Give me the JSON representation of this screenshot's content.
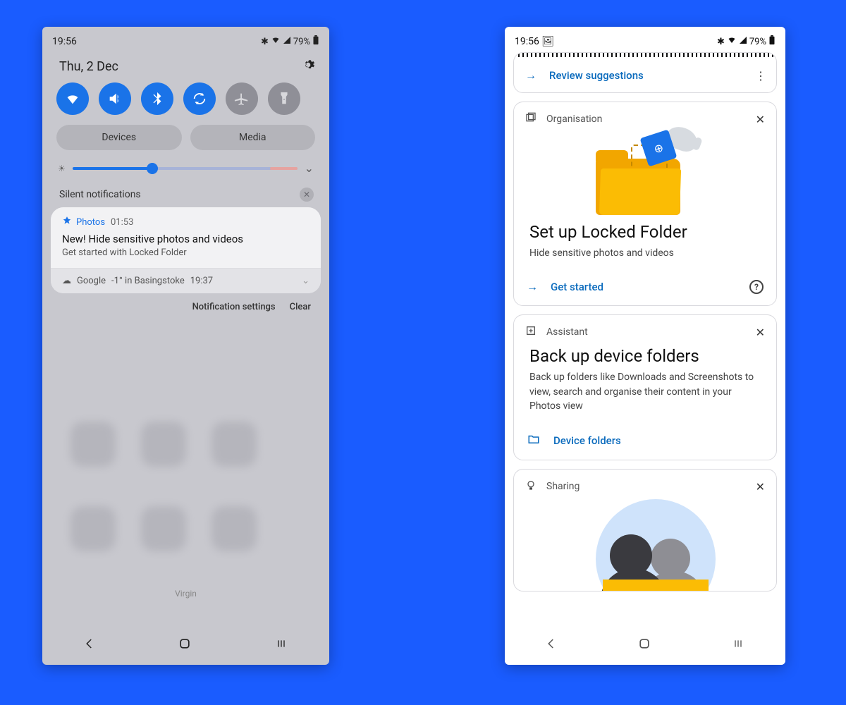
{
  "left": {
    "status": {
      "time": "19:56",
      "battery": "79%"
    },
    "date": "Thu, 2 Dec",
    "pills": {
      "devices": "Devices",
      "media": "Media"
    },
    "silent_label": "Silent notifications",
    "notification": {
      "app": "Photos",
      "time": "01:53",
      "title": "New! Hide sensitive photos and videos",
      "subtitle": "Get started with Locked Folder"
    },
    "weather": {
      "app": "Google",
      "text": "-1° in Basingstoke",
      "time": "19:37"
    },
    "actions": {
      "settings": "Notification settings",
      "clear": "Clear"
    },
    "carrier": "Virgin"
  },
  "right": {
    "status": {
      "time": "19:56",
      "battery": "79%"
    },
    "review_label": "Review suggestions",
    "card_org": {
      "category": "Organisation",
      "title": "Set up Locked Folder",
      "desc": "Hide sensitive photos and videos",
      "cta": "Get started"
    },
    "card_assist": {
      "category": "Assistant",
      "title": "Back up device folders",
      "desc": "Back up folders like Downloads and Screenshots to view, search and organise their content in your Photos view",
      "cta": "Device folders"
    },
    "card_share": {
      "category": "Sharing"
    }
  }
}
